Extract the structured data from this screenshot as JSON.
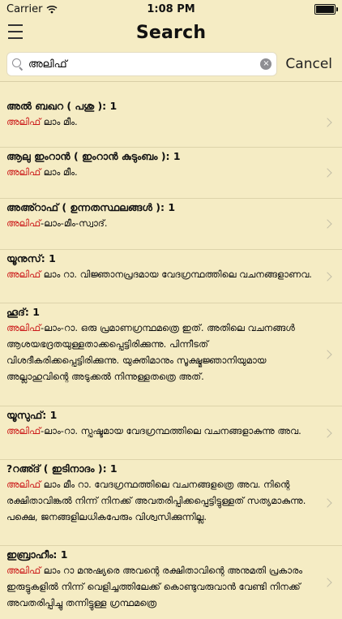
{
  "status_bar": {
    "carrier": "Carrier",
    "time": "1:08 PM",
    "battery_level": 1.0
  },
  "nav": {
    "title": "Search"
  },
  "search": {
    "value": "അലിഫ്",
    "cancel_label": "Cancel",
    "clear_symbol": "×"
  },
  "results": [
    {
      "title": "അൽ ബഖറ ( പശു ): 1",
      "highlight": "അലിഫ്",
      "rest": " ലാം മീം."
    },
    {
      "title": "ആലു ഇംറാൻ ( ഇംറാൻ കുടുംബം ): 1",
      "highlight": "അലിഫ്",
      "rest": " ലാം മീം."
    },
    {
      "title": "അഅ്റാഫ് ( ഉന്നതസ്ഥലങ്ങൾ ): 1",
      "highlight": "അലിഫ്",
      "rest": "-ലാം-മീം-സ്വാദ്."
    },
    {
      "title": "യൂനുസ്: 1",
      "highlight": "അലിഫ്",
      "rest": " ലാം റാ. വിജ്ഞാനപ്രദമായ വേദഗ്രന്ഥത്തിലെ വചനങ്ങളാണവ."
    },
    {
      "title": "ഹൂദ്: 1",
      "highlight": "അലിഫ്",
      "rest": "-ലാം-റാ. ഒരു പ്രമാണഗ്രന്ഥമത്രെ ഇത്. അതിലെ വചനങ്ങൾ ആശയഭദ്രതയുള്ളതാക്കപ്പെട്ടിരിക്കുന്നു. പിന്നീടത് വിശദീകരിക്കപ്പെട്ടിരിക്കുന്നു. യുക്തിമാനും സൂക്ഷ്മജ്ഞാനിയുമായ അല്ലാഹുവിന്റെ അടുക്കൽ നിന്നുള്ളതത്രെ അത്."
    },
    {
      "title": "യൂസുഫ്: 1",
      "highlight": "അലിഫ്",
      "rest": "-ലാം-റാ. സ്പഷ്ടമായ വേദഗ്രന്ഥത്തിലെ വചനങ്ങളാകുന്നു അവ."
    },
    {
      "title": "?റഅ്ദ് ( ഇടിനാദം ): 1",
      "highlight": "അലിഫ്",
      "rest": " ലാം മീം റാ. വേദഗ്രന്ഥത്തിലെ വചനങ്ങളത്രെ അവ. നിന്റെ രക്ഷിതാവിങ്കൽ നിന്ന് നിനക്ക് അവതരിപ്പിക്കപ്പെട്ടിട്ടുള്ളത് സത്യമാകുന്നു. പക്ഷെ, ജനങ്ങളിലധികപേരും വിശ്വസിക്കുന്നില്ല."
    },
    {
      "title": "ഇബ്രാഹീം: 1",
      "highlight": "അലിഫ്",
      "rest": " ലാം റാ മനുഷ്യരെ അവന്റെ രക്ഷിതാവിന്റെ അനുമതി പ്രകാരം ഇരുട്ടുകളിൽ നിന്ന് വെളിച്ചത്തിലേക്ക് കൊണ്ടുവരുവാൻ വേണ്ടി നിനക്ക് അവതരിപ്പിച്ചു തന്നിട്ടുള്ള ഗ്രന്ഥമത്രെ"
    }
  ]
}
